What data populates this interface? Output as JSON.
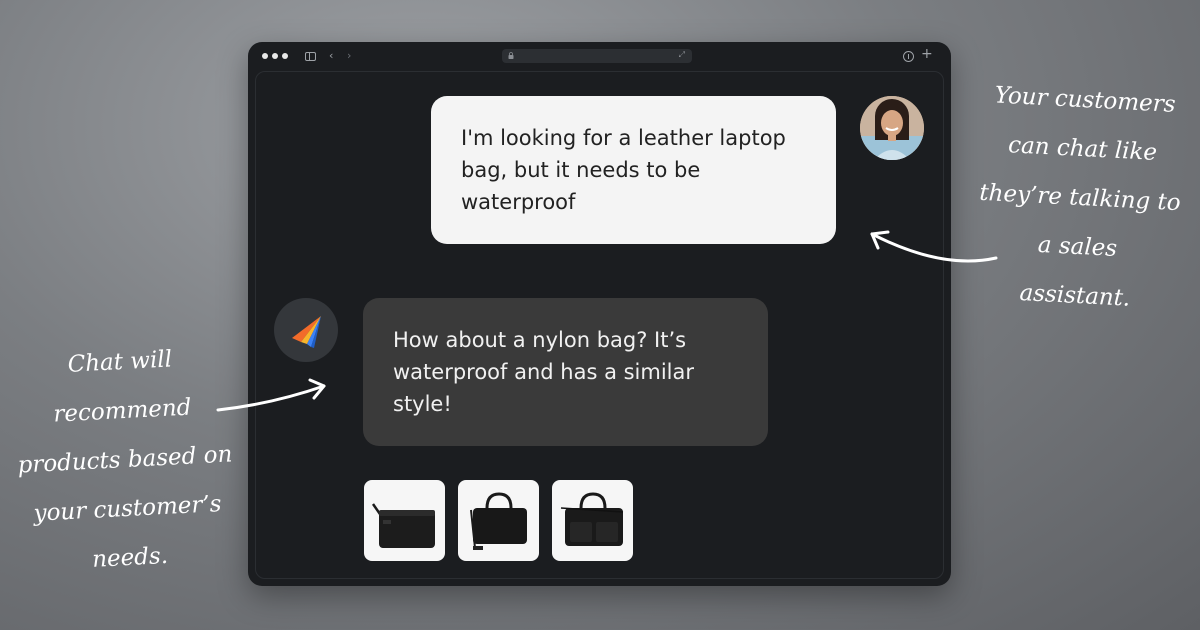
{
  "chat": {
    "user_message": "I'm looking for a leather laptop bag, but it needs to be waterproof",
    "bot_message": "How about a nylon bag? It’s waterproof and has a similar style!",
    "products": [
      {
        "icon": "crossbody-bag-icon"
      },
      {
        "icon": "briefcase-bag-icon"
      },
      {
        "icon": "laptop-bag-icon"
      }
    ]
  },
  "annotations": {
    "right_note": [
      "Your customers",
      "can chat like",
      "they’re talking to",
      "a sales",
      "assistant."
    ],
    "left_note": [
      "Chat will",
      "recommend",
      "products based on",
      "your customer’s",
      "needs."
    ]
  },
  "colors": {
    "page_background": "#7b7e82",
    "window_background": "#1b1d20",
    "user_bubble": "#f4f4f4",
    "bot_bubble": "#3a3a3a",
    "logo_orange": "#f26b2a",
    "logo_blue": "#3b82f6"
  }
}
